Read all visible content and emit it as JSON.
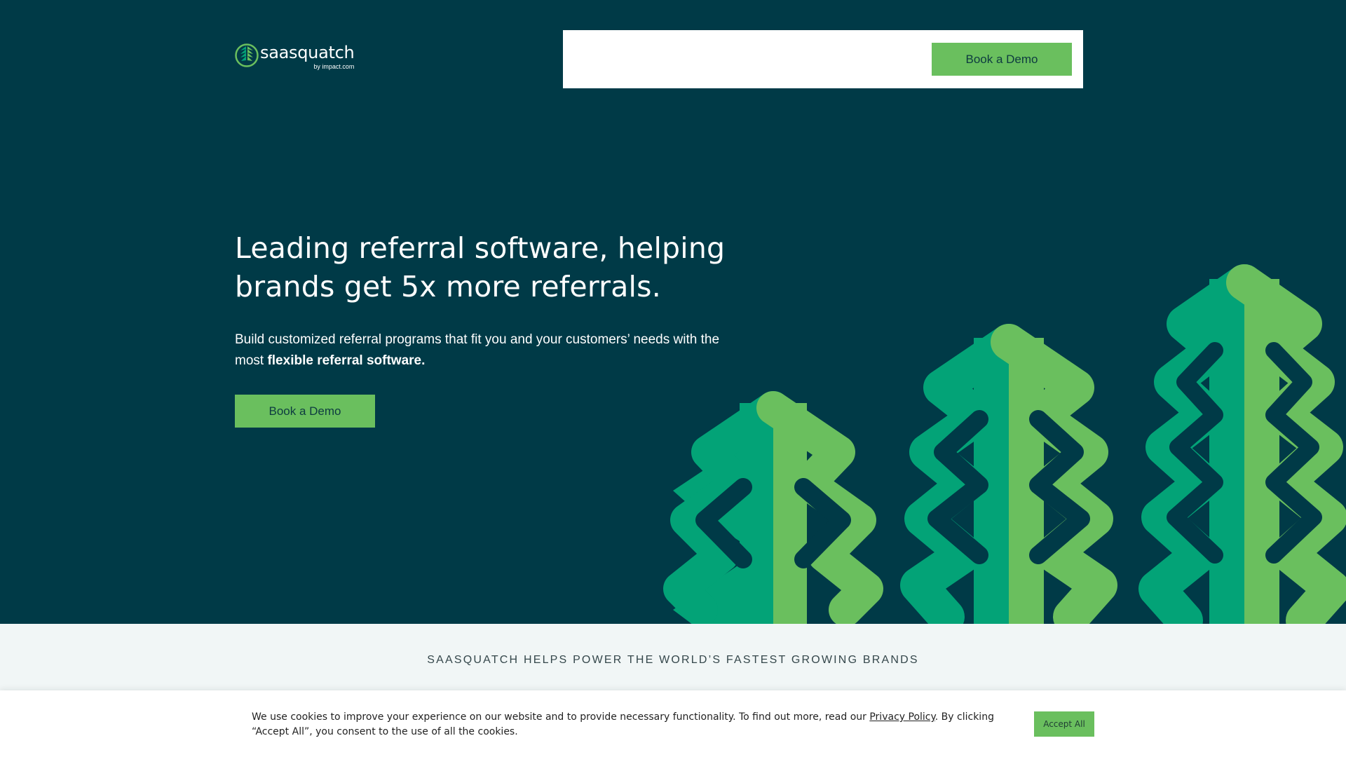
{
  "header": {
    "logo_name": "saasquatch",
    "logo_sub": "by impact.com",
    "demo_label": "Book a Demo"
  },
  "hero": {
    "headline_line1": "Leading referral software, helping",
    "headline_line2": "brands get 5x more referrals.",
    "sub_line1": "Build customized referral programs that fit you and your customers’ needs with the",
    "sub_line2_prefix": "most ",
    "sub_line2_bold": "flexible referral software.",
    "demo_label": "Book a Demo"
  },
  "brands": {
    "title": "SAASQUATCH HELPS POWER THE WORLD’S FASTEST GROWING BRANDS"
  },
  "cookie": {
    "text_before": "We use cookies to improve your experience on our website and to provide necessary functionality. To find out more, read our ",
    "link_label": "Privacy Policy",
    "text_after": ". By clicking “Accept All”, you consent to the use of all the cookies.",
    "accept_label": "Accept All"
  },
  "colors": {
    "background": "#003a47",
    "accent_green": "#6abf5e",
    "tree_dark": "#03a377",
    "tree_light": "#6abf5e",
    "band": "#f1f6f6"
  }
}
